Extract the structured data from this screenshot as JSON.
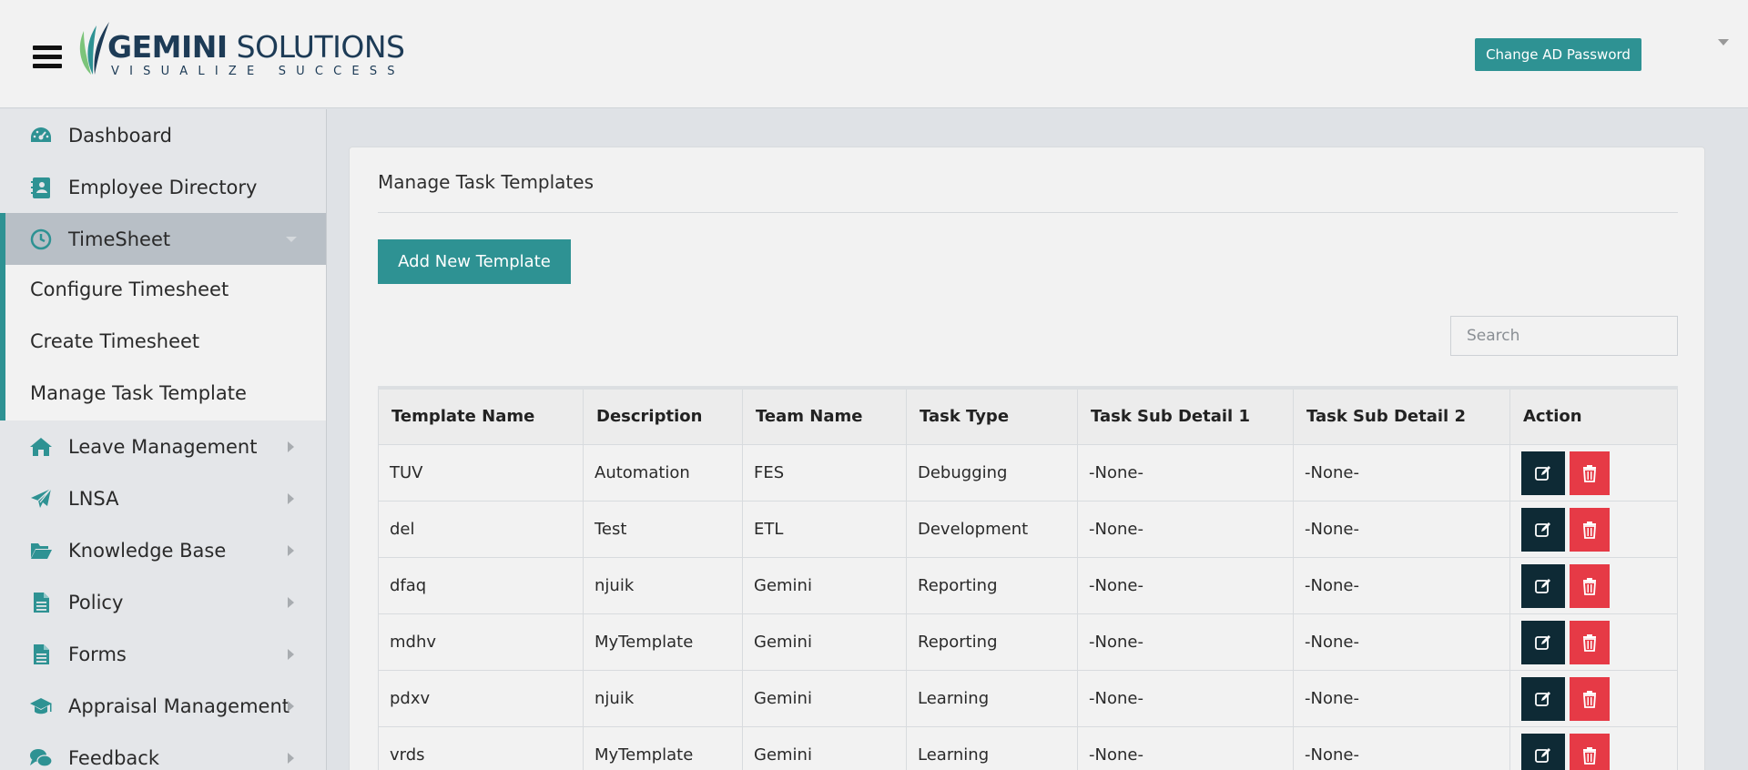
{
  "header": {
    "logo_name_bold": "GEMINI",
    "logo_name_light": " SOLUTIONS",
    "logo_tagline": "VISUALIZE SUCCESS",
    "change_password_label": "Change AD Password"
  },
  "sidebar": {
    "items": [
      {
        "label": "Dashboard",
        "icon": "dashboard-icon"
      },
      {
        "label": "Employee Directory",
        "icon": "contact-book-icon"
      },
      {
        "label": "TimeSheet",
        "icon": "clock-icon",
        "active": true
      },
      {
        "label": "Leave Management",
        "icon": "home-icon"
      },
      {
        "label": "LNSA",
        "icon": "paper-plane-icon"
      },
      {
        "label": "Knowledge Base",
        "icon": "folder-open-icon"
      },
      {
        "label": "Policy",
        "icon": "document-icon"
      },
      {
        "label": "Forms",
        "icon": "document-icon"
      },
      {
        "label": "Appraisal Management",
        "icon": "graduation-cap-icon"
      },
      {
        "label": "Feedback",
        "icon": "chat-icon"
      }
    ],
    "timesheet_sub": [
      {
        "label": "Configure Timesheet"
      },
      {
        "label": "Create Timesheet"
      },
      {
        "label": "Manage Task Template"
      }
    ]
  },
  "main": {
    "title": "Manage Task Templates",
    "add_button_label": "Add New Template",
    "search_placeholder": "Search",
    "table": {
      "headers": [
        "Template Name",
        "Description",
        "Team Name",
        "Task Type",
        "Task Sub Detail 1",
        "Task Sub Detail 2",
        "Action"
      ],
      "rows": [
        [
          "TUV",
          "Automation",
          "FES",
          "Debugging",
          "-None-",
          "-None-"
        ],
        [
          "del",
          "Test",
          "ETL",
          "Development",
          "-None-",
          "-None-"
        ],
        [
          "dfaq",
          "njuik",
          "Gemini",
          "Reporting",
          "-None-",
          "-None-"
        ],
        [
          "mdhv",
          "MyTemplate",
          "Gemini",
          "Reporting",
          "-None-",
          "-None-"
        ],
        [
          "pdxv",
          "njuik",
          "Gemini",
          "Learning",
          "-None-",
          "-None-"
        ],
        [
          "vrds",
          "MyTemplate",
          "Gemini",
          "Learning",
          "-None-",
          "-None-"
        ]
      ]
    }
  },
  "colors": {
    "accent": "#2e9293",
    "edit_button": "#0e2a35",
    "delete_button": "#e63a46"
  }
}
